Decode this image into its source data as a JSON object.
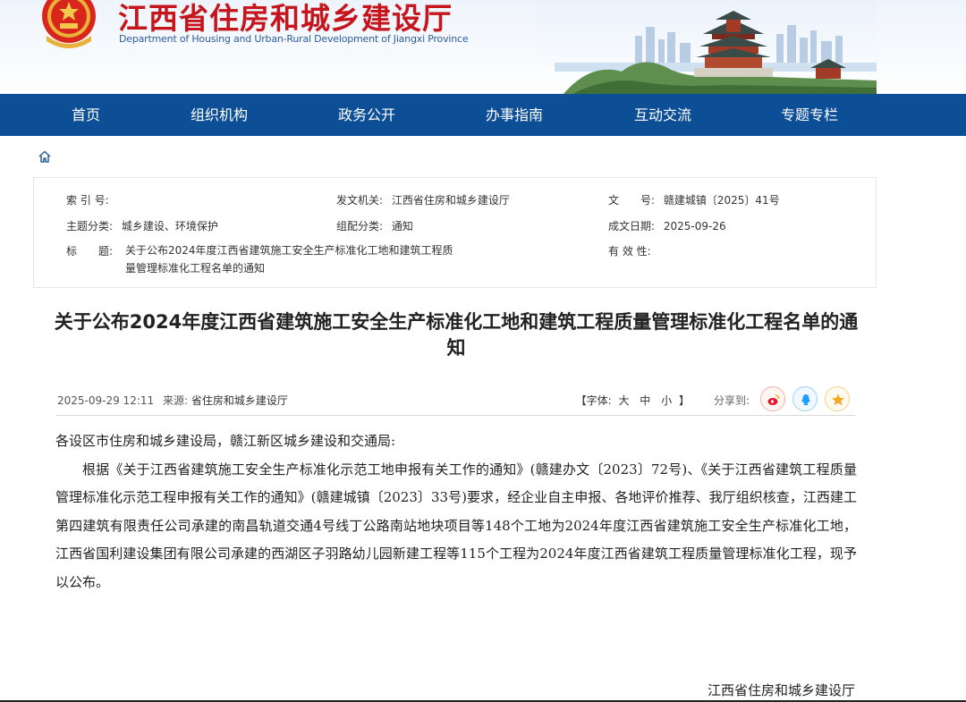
{
  "header": {
    "title": "江西省住房和城乡建设厅",
    "subtitle": "Department of Housing and Urban-Rural Development of Jiangxi Province"
  },
  "nav": {
    "items": [
      {
        "label": "首页"
      },
      {
        "label": "组织机构"
      },
      {
        "label": "政务公开"
      },
      {
        "label": "办事指南"
      },
      {
        "label": "互动交流"
      },
      {
        "label": "专题专栏"
      }
    ]
  },
  "meta": {
    "index_label": "索 引 号:",
    "index_value": "",
    "issuer_label": "发文机关:",
    "issuer_value": "江西省住房和城乡建设厅",
    "doc_no_label": "文　　号:",
    "doc_no_value": "赣建城镇〔2025〕41号",
    "topic_label": "主题分类:",
    "topic_value": "城乡建设、环境保护",
    "category_label": "组配分类:",
    "category_value": "通知",
    "date_label": "成文日期:",
    "date_value": "2025-09-26",
    "title_label": "标　　题:",
    "title_value": "关于公布2024年度江西省建筑施工安全生产标准化工地和建筑工程质量管理标准化工程名单的通知",
    "validity_label": "有 效 性:",
    "validity_value": ""
  },
  "article": {
    "title": "关于公布2024年度江西省建筑施工安全生产标准化工地和建筑工程质量管理标准化工程名单的通知",
    "datetime": "2025-09-29 12:11",
    "source_label": "来源:",
    "source": "省住房和城乡建设厅",
    "font_label_open": "【字体:",
    "font_large": "大",
    "font_medium": "中",
    "font_small": "小",
    "font_label_close": "】",
    "share_label": "分享到:",
    "salutation": "各设区市住房和城乡建设局，赣江新区城乡建设和交通局:",
    "paragraph": "根据《关于江西省建筑施工安全生产标准化示范工地申报有关工作的通知》(赣建办文〔2023〕72号)、《关于江西省建筑工程质量管理标准化示范工程申报有关工作的通知》(赣建城镇〔2023〕33号)要求，经企业自主申报、各地评价推荐、我厅组织核查，江西建工第四建筑有限责任公司承建的南昌轨道交通4号线丁公路南站地块项目等148个工地为2024年度江西省建筑施工安全生产标准化工地，江西省国利建设集团有限公司承建的西湖区子羽路幼儿园新建工程等115个工程为2024年度江西省建筑工程质量管理标准化工程，现予以公布。",
    "signature": "江西省住房和城乡建设厅"
  },
  "icons": {
    "home": "home-icon",
    "weibo": "weibo-icon",
    "qq": "qq-icon",
    "qzone": "qzone-icon"
  },
  "colors": {
    "brand_red": "#c4161c",
    "nav_blue": "#0d4f96",
    "weibo": "#e6162d",
    "qq": "#1e9fff",
    "qzone": "#f5a623"
  }
}
